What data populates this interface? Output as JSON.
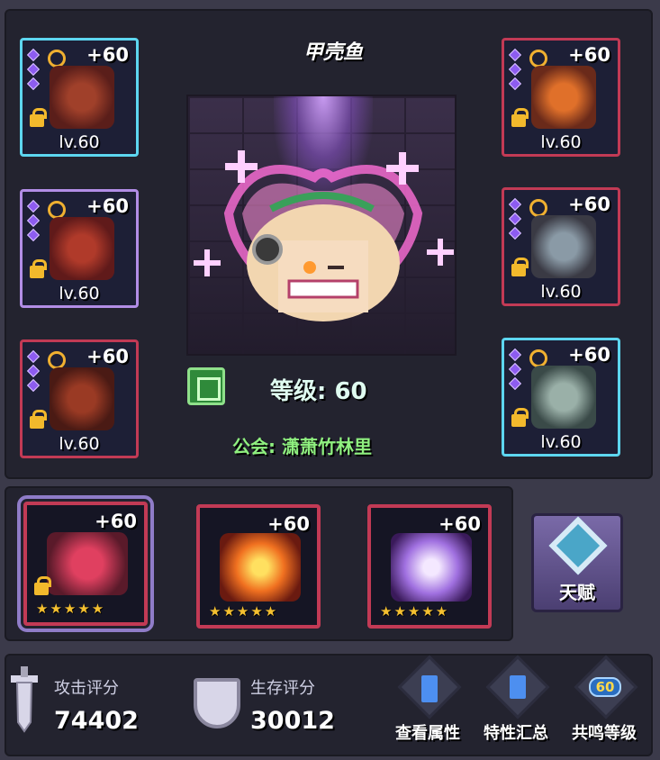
{
  "hero": {
    "name": "甲壳鱼",
    "level_text": "等级: 60",
    "guild_text": "公会: 潇萧竹林里"
  },
  "left_equipment": [
    {
      "plus": "+60",
      "level": "lv.60",
      "icon": "armor-chest-icon"
    },
    {
      "plus": "+60",
      "level": "lv.60",
      "icon": "cape-armor-icon"
    },
    {
      "plus": "+60",
      "level": "lv.60",
      "icon": "heavy-armor-icon"
    }
  ],
  "right_equipment": [
    {
      "plus": "+60",
      "level": "lv.60",
      "icon": "dragon-helmet-icon"
    },
    {
      "plus": "+60",
      "level": "lv.60",
      "icon": "pauldron-icon"
    },
    {
      "plus": "+60",
      "level": "lv.60",
      "icon": "boots-icon"
    }
  ],
  "artifacts": [
    {
      "plus": "+60",
      "stars": "★★★★★",
      "icon": "shield-weapon-icon"
    },
    {
      "plus": "+60",
      "stars": "★★★★★",
      "icon": "fire-gem-icon"
    },
    {
      "plus": "+60",
      "stars": "★★★★★",
      "icon": "purple-crystal-icon"
    }
  ],
  "talent": {
    "label": "天赋"
  },
  "stats": {
    "attack_label": "攻击评分",
    "attack_value": "74402",
    "survival_label": "生存评分",
    "survival_value": "30012"
  },
  "actions": [
    {
      "label": "查看属性"
    },
    {
      "label": "特性汇总"
    },
    {
      "label": "共鸣等级",
      "badge": "60"
    }
  ],
  "colors": {
    "red_border": "#c23a55",
    "cyan_border": "#5dd6f0",
    "guild_green": "#8ff07f"
  }
}
